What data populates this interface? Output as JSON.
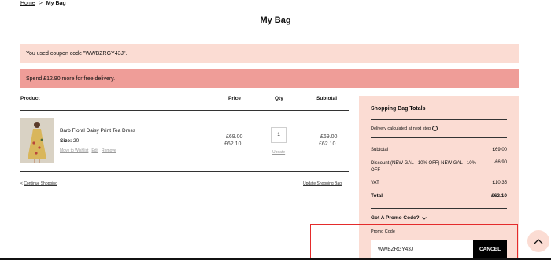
{
  "breadcrumb": {
    "home": "Home",
    "separator": ">",
    "current": "My Bag"
  },
  "page_title": "My Bag",
  "notices": {
    "coupon": "You used coupon code \"WWBZRGY43J\".",
    "delivery": "Spend £12.90 more for free delivery."
  },
  "colors": {
    "coupon_bg": "#fbdcd3",
    "delivery_bg": "#ef9d98",
    "highlight": "#e42b2b",
    "button_bg": "#000000"
  },
  "table": {
    "headers": {
      "product": "Product",
      "price": "Price",
      "qty": "Qty",
      "subtotal": "Subtotal"
    },
    "item": {
      "name": "Barb Floral Daisy Print Tea Dress",
      "size_label": "Size:",
      "size": "20",
      "actions": [
        "Move to Wishlist",
        "Edit",
        "Remove"
      ],
      "price_old": "£69.00",
      "price_new": "£62.10",
      "qty": "1",
      "qty_update": "Update",
      "subtotal_old": "£69.00",
      "subtotal_new": "£62.10"
    }
  },
  "links": {
    "continue_arrow": "<",
    "continue": "Continue Shopping",
    "update_bag": "Update Shopping Bag"
  },
  "totals": {
    "title": "Shopping Bag Totals",
    "delivery_note": "Delivery calculated at next step",
    "rows": [
      {
        "label": "Subtotal",
        "value": "£69.00"
      },
      {
        "label": "Discount (NEW GAL - 10% OFF) NEW GAL - 10% OFF",
        "value": "-£6.90"
      },
      {
        "label": "VAT",
        "value": "£10.35"
      },
      {
        "label": "Total",
        "value": "£62.10"
      }
    ]
  },
  "promo": {
    "title": "Got A Promo Code?",
    "label": "Promo Code",
    "value": "WWBZRGY43J",
    "cancel_label": "CANCEL"
  },
  "icons": {
    "info": "info-icon",
    "chevron": "chevron-down-icon",
    "scroll_top": "chevron-up-icon"
  }
}
